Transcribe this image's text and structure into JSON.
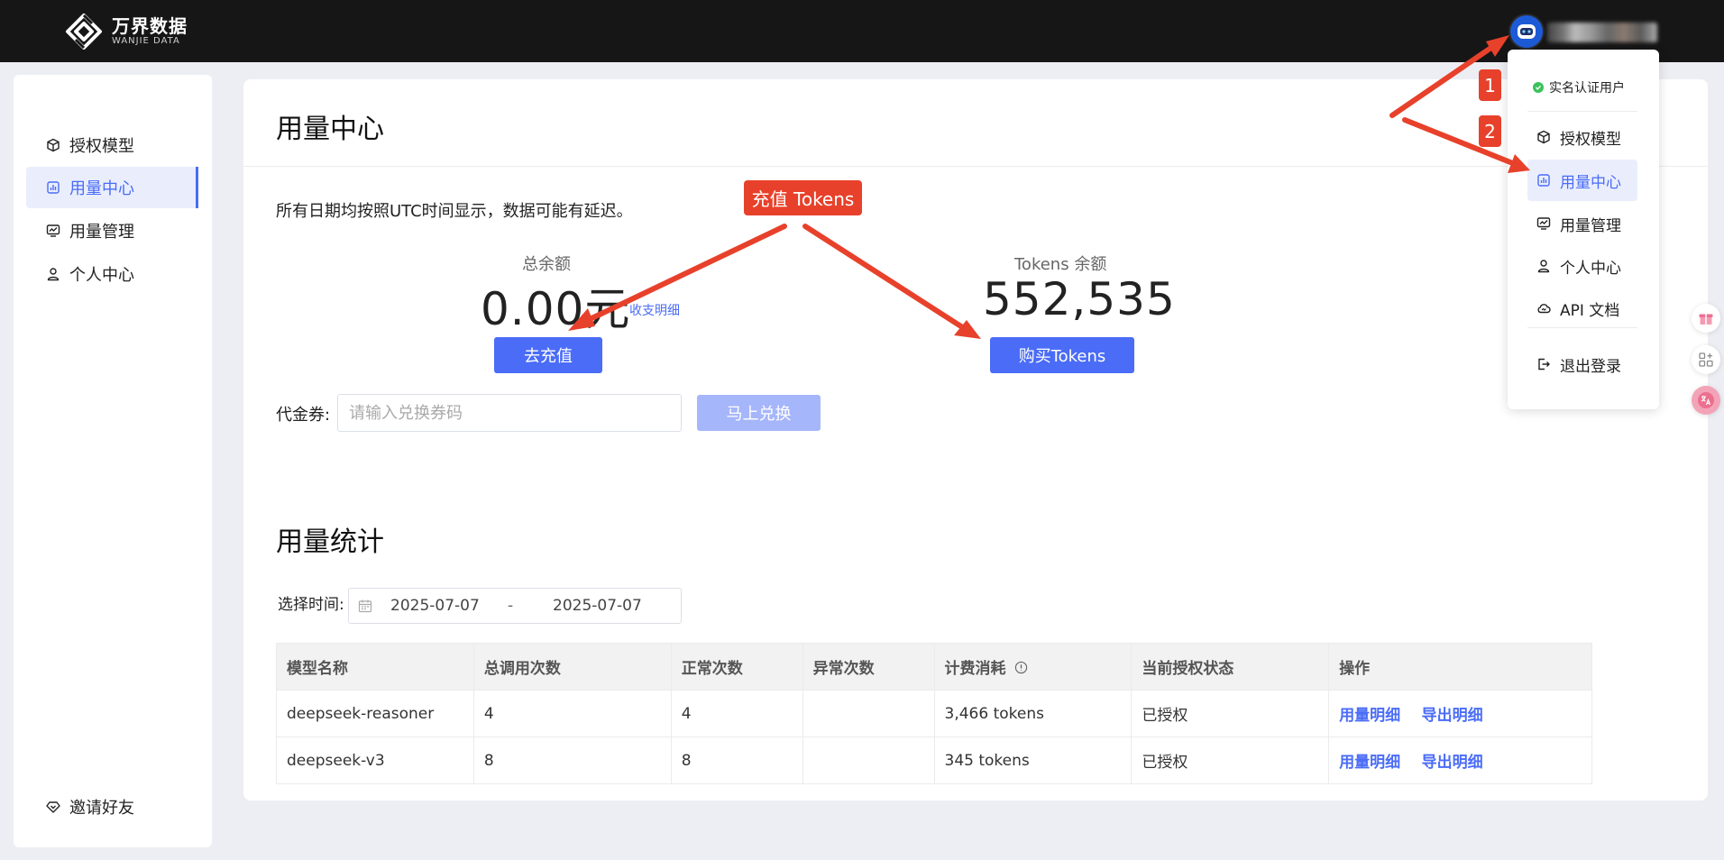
{
  "brand": {
    "name": "万界数据",
    "sub": "WANJIE DATA"
  },
  "sidebar": {
    "items": [
      {
        "label": "授权模型",
        "icon": "cube-icon"
      },
      {
        "label": "用量中心",
        "icon": "chart-icon",
        "active": true
      },
      {
        "label": "用量管理",
        "icon": "monitor-chart-icon"
      },
      {
        "label": "个人中心",
        "icon": "user-icon"
      }
    ],
    "invite": {
      "label": "邀请好友",
      "icon": "diamond-icon"
    }
  },
  "main": {
    "title": "用量中心",
    "note": "所有日期均按照UTC时间显示，数据可能有延迟。",
    "balance": {
      "label": "总余额",
      "value": "0.00元",
      "detail_link": "收支明细",
      "button": "去充值"
    },
    "tokens": {
      "label": "Tokens 余额",
      "value": "552,535",
      "button": "购买Tokens"
    },
    "coupon": {
      "label": "代金券:",
      "placeholder": "请输入兑换券码",
      "button": "马上兑换"
    },
    "stats": {
      "title": "用量统计",
      "time_label": "选择时间:",
      "date_start": "2025-07-07",
      "date_sep": "-",
      "date_end": "2025-07-07",
      "columns": [
        "模型名称",
        "总调用次数",
        "正常次数",
        "异常次数",
        "计费消耗",
        "当前授权状态",
        "操作"
      ],
      "rows": [
        {
          "model": "deepseek-reasoner",
          "total": "4",
          "normal": "4",
          "abnormal": "",
          "cost": "3,466 tokens",
          "status": "已授权",
          "action1": "用量明细",
          "action2": "导出明细"
        },
        {
          "model": "deepseek-v3",
          "total": "8",
          "normal": "8",
          "abnormal": "",
          "cost": "345 tokens",
          "status": "已授权",
          "action1": "用量明细",
          "action2": "导出明细"
        }
      ]
    }
  },
  "dropdown": {
    "verified": "实名认证用户",
    "items": [
      {
        "label": "授权模型",
        "icon": "cube-icon"
      },
      {
        "label": "用量中心",
        "icon": "chart-icon",
        "active": true
      },
      {
        "label": "用量管理",
        "icon": "monitor-chart-icon"
      },
      {
        "label": "个人中心",
        "icon": "user-icon"
      },
      {
        "label": "API 文档",
        "icon": "cloud-icon"
      }
    ],
    "logout": "退出登录"
  },
  "annotations": {
    "recharge_tokens": "充值 Tokens",
    "step1": "1",
    "step2": "2"
  },
  "colors": {
    "accent": "#4a6cf7",
    "annotation": "#e8412b",
    "topbar": "#161616"
  }
}
